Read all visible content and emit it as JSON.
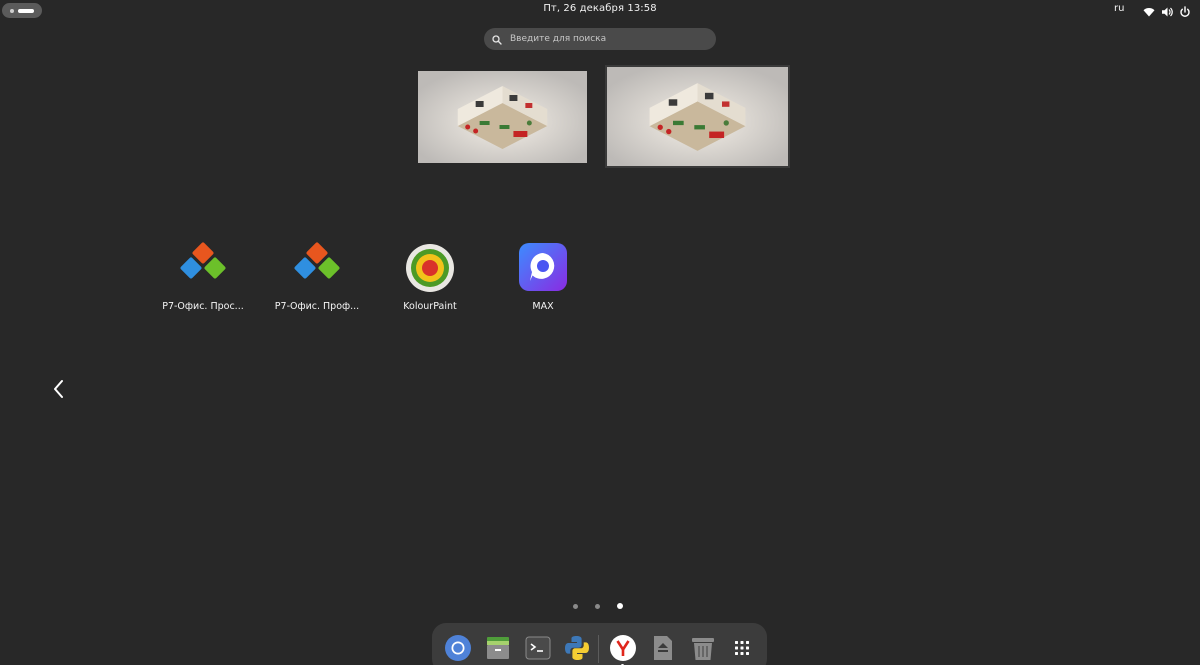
{
  "topbar": {
    "clock": "Пт, 26 декабря  13:58",
    "language": "ru",
    "icons": [
      "activities-indicator",
      "wifi-icon",
      "volume-icon",
      "power-icon"
    ]
  },
  "search": {
    "placeholder": "Введите для поиска",
    "value": ""
  },
  "workspaces": [
    {
      "name": "workspace-1",
      "preview": "isometric-office-wallpaper"
    },
    {
      "name": "workspace-2",
      "preview": "isometric-office-wallpaper"
    }
  ],
  "apps": [
    {
      "label": "Р7-Офис. Прос...",
      "icon": "r7-office-icon"
    },
    {
      "label": "Р7-Офис. Проф...",
      "icon": "r7-office-icon"
    },
    {
      "label": "KolourPaint",
      "icon": "kolourpaint-icon"
    },
    {
      "label": "MAX",
      "icon": "max-messenger-icon"
    }
  ],
  "pagination": {
    "pages": 3,
    "current_page": 3
  },
  "dock": {
    "items": [
      "chromium-icon",
      "archive-manager-icon",
      "terminal-icon",
      "python-icon",
      "yandex-browser-icon",
      "eject-drive-icon",
      "trash-icon",
      "show-apps-grid-icon"
    ],
    "running": "yandex-browser-icon"
  },
  "colors": {
    "background": "#282828",
    "search_bg": "#4a4a4a",
    "dock_bg": "#3c3c3c",
    "r7_orange": "#e8561e",
    "r7_blue": "#2f8fe0",
    "r7_green": "#6cc02a",
    "max_purple": "#5a3cf0"
  }
}
